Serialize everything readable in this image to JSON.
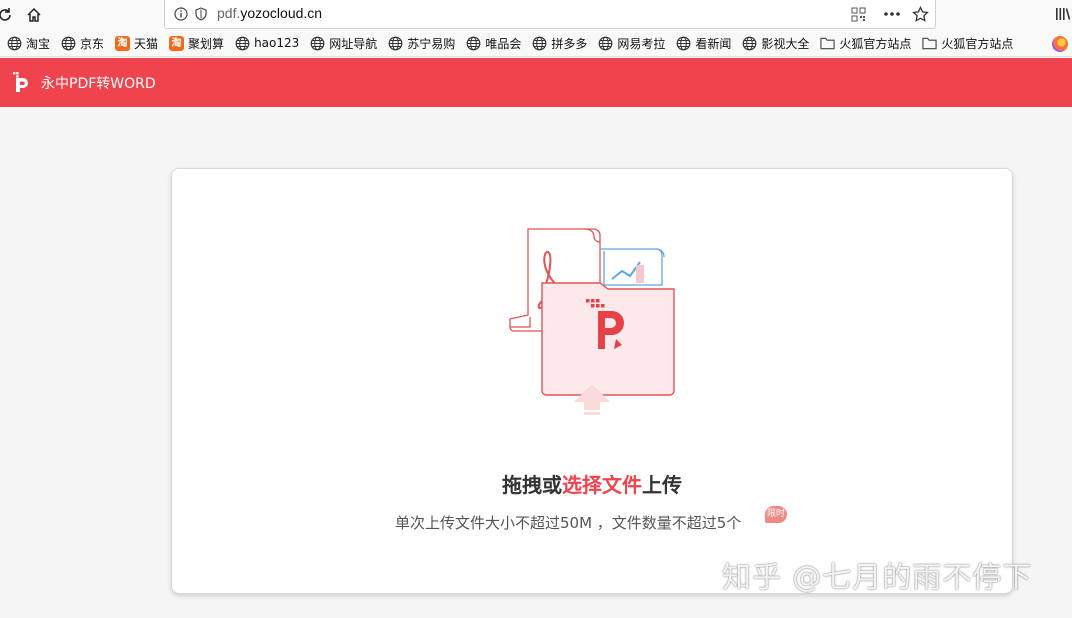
{
  "browser": {
    "url_prefix": "pdf.",
    "url_domain": "yozocloud.cn",
    "bookmarks": [
      {
        "label": "淘宝",
        "icon": "globe-icon"
      },
      {
        "label": "京东",
        "icon": "globe-icon"
      },
      {
        "label": "天猫",
        "icon": "taobao-icon"
      },
      {
        "label": "聚划算",
        "icon": "taobao-icon"
      },
      {
        "label": "hao123",
        "icon": "globe-icon"
      },
      {
        "label": "网址导航",
        "icon": "globe-icon"
      },
      {
        "label": "苏宁易购",
        "icon": "globe-icon"
      },
      {
        "label": "唯品会",
        "icon": "globe-icon"
      },
      {
        "label": "拼多多",
        "icon": "globe-icon"
      },
      {
        "label": "网易考拉",
        "icon": "globe-icon"
      },
      {
        "label": "看新闻",
        "icon": "globe-icon"
      },
      {
        "label": "影视大全",
        "icon": "globe-icon"
      },
      {
        "label": "火狐官方站点",
        "icon": "folder-icon"
      },
      {
        "label": "火狐官方站点",
        "icon": "folder-icon"
      }
    ],
    "taobao_glyph": "淘"
  },
  "app": {
    "title": "永中PDF转WORD",
    "accent_color": "#ef434d"
  },
  "upload": {
    "title_prefix": "拖拽或",
    "title_link": "选择文件",
    "title_suffix": "上传",
    "subtitle": "单次上传文件大小不超过50M ，文件数量不超过5个",
    "badge": "限时"
  },
  "watermark": "知乎 @七月的雨不停下"
}
